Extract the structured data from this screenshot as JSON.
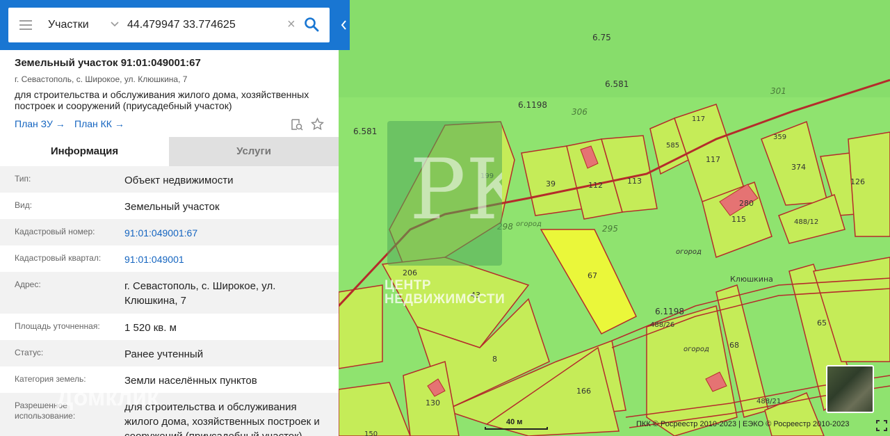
{
  "search": {
    "layer": "Участки",
    "query": "44.479947 33.774625"
  },
  "plot": {
    "title": "Земельный участок 91:01:049001:67",
    "address": "г. Севастополь, с. Широкое, ул. Клюшкина, 7",
    "purpose": "для строительства и обслуживания жилого дома, хозяйственных построек и сооружений (приусадебный участок)",
    "plan_zu": "План ЗУ →",
    "plan_kk": "План КК →"
  },
  "tabs": {
    "info": "Информация",
    "services": "Услуги"
  },
  "info": [
    {
      "k": "Тип:",
      "v": "Объект недвижимости"
    },
    {
      "k": "Вид:",
      "v": "Земельный участок"
    },
    {
      "k": "Кадастровый номер:",
      "v": "91:01:049001:67"
    },
    {
      "k": "Кадастровый квартал:",
      "v": "91:01:049001"
    },
    {
      "k": "Адрес:",
      "v": "г. Севастополь, с. Широкое, ул. Клюшкина, 7"
    },
    {
      "k": "Площадь уточненная:",
      "v": "1 520 кв. м"
    },
    {
      "k": "Статус:",
      "v": "Ранее учтенный"
    },
    {
      "k": "Категория земель:",
      "v": "Земли населённых пунктов"
    },
    {
      "k": "Разрешенное использование:",
      "v": "для строительства и обслуживания жилого дома, хозяйственных построек и сооружений (приусадебный участок)"
    }
  ],
  "map": {
    "labels": [
      "6.75",
      "6.581",
      "6.1198",
      "306",
      "301",
      "6.581",
      "199",
      "298",
      "огород",
      "295",
      "117",
      "117",
      "585",
      "359",
      "374",
      "126",
      "39",
      "112",
      "113",
      "280",
      "115",
      "488/12",
      "огород",
      "206",
      "43",
      "67",
      "6.1198",
      "488/26",
      "Клюшкина",
      "65",
      "8",
      "огород",
      "68",
      "166",
      "130",
      "488/21",
      "150"
    ],
    "logo_text": "ЦЕНТР НЕДВИЖИМОСТИ",
    "logo_letters": "РК",
    "watermark": "Домклик",
    "scale": "40 м",
    "copyright": "ПКК © Росреестр 2010-2023 | ЕЭКО © Росреестр 2010-2023"
  },
  "colors": {
    "topbar": "#1976d2",
    "map_bg": "#8fe36f",
    "parcel_fill": "#c6ef5a",
    "selected_parcel": "#e6f53a",
    "border": "#b52b2b",
    "link": "#1565c0"
  }
}
